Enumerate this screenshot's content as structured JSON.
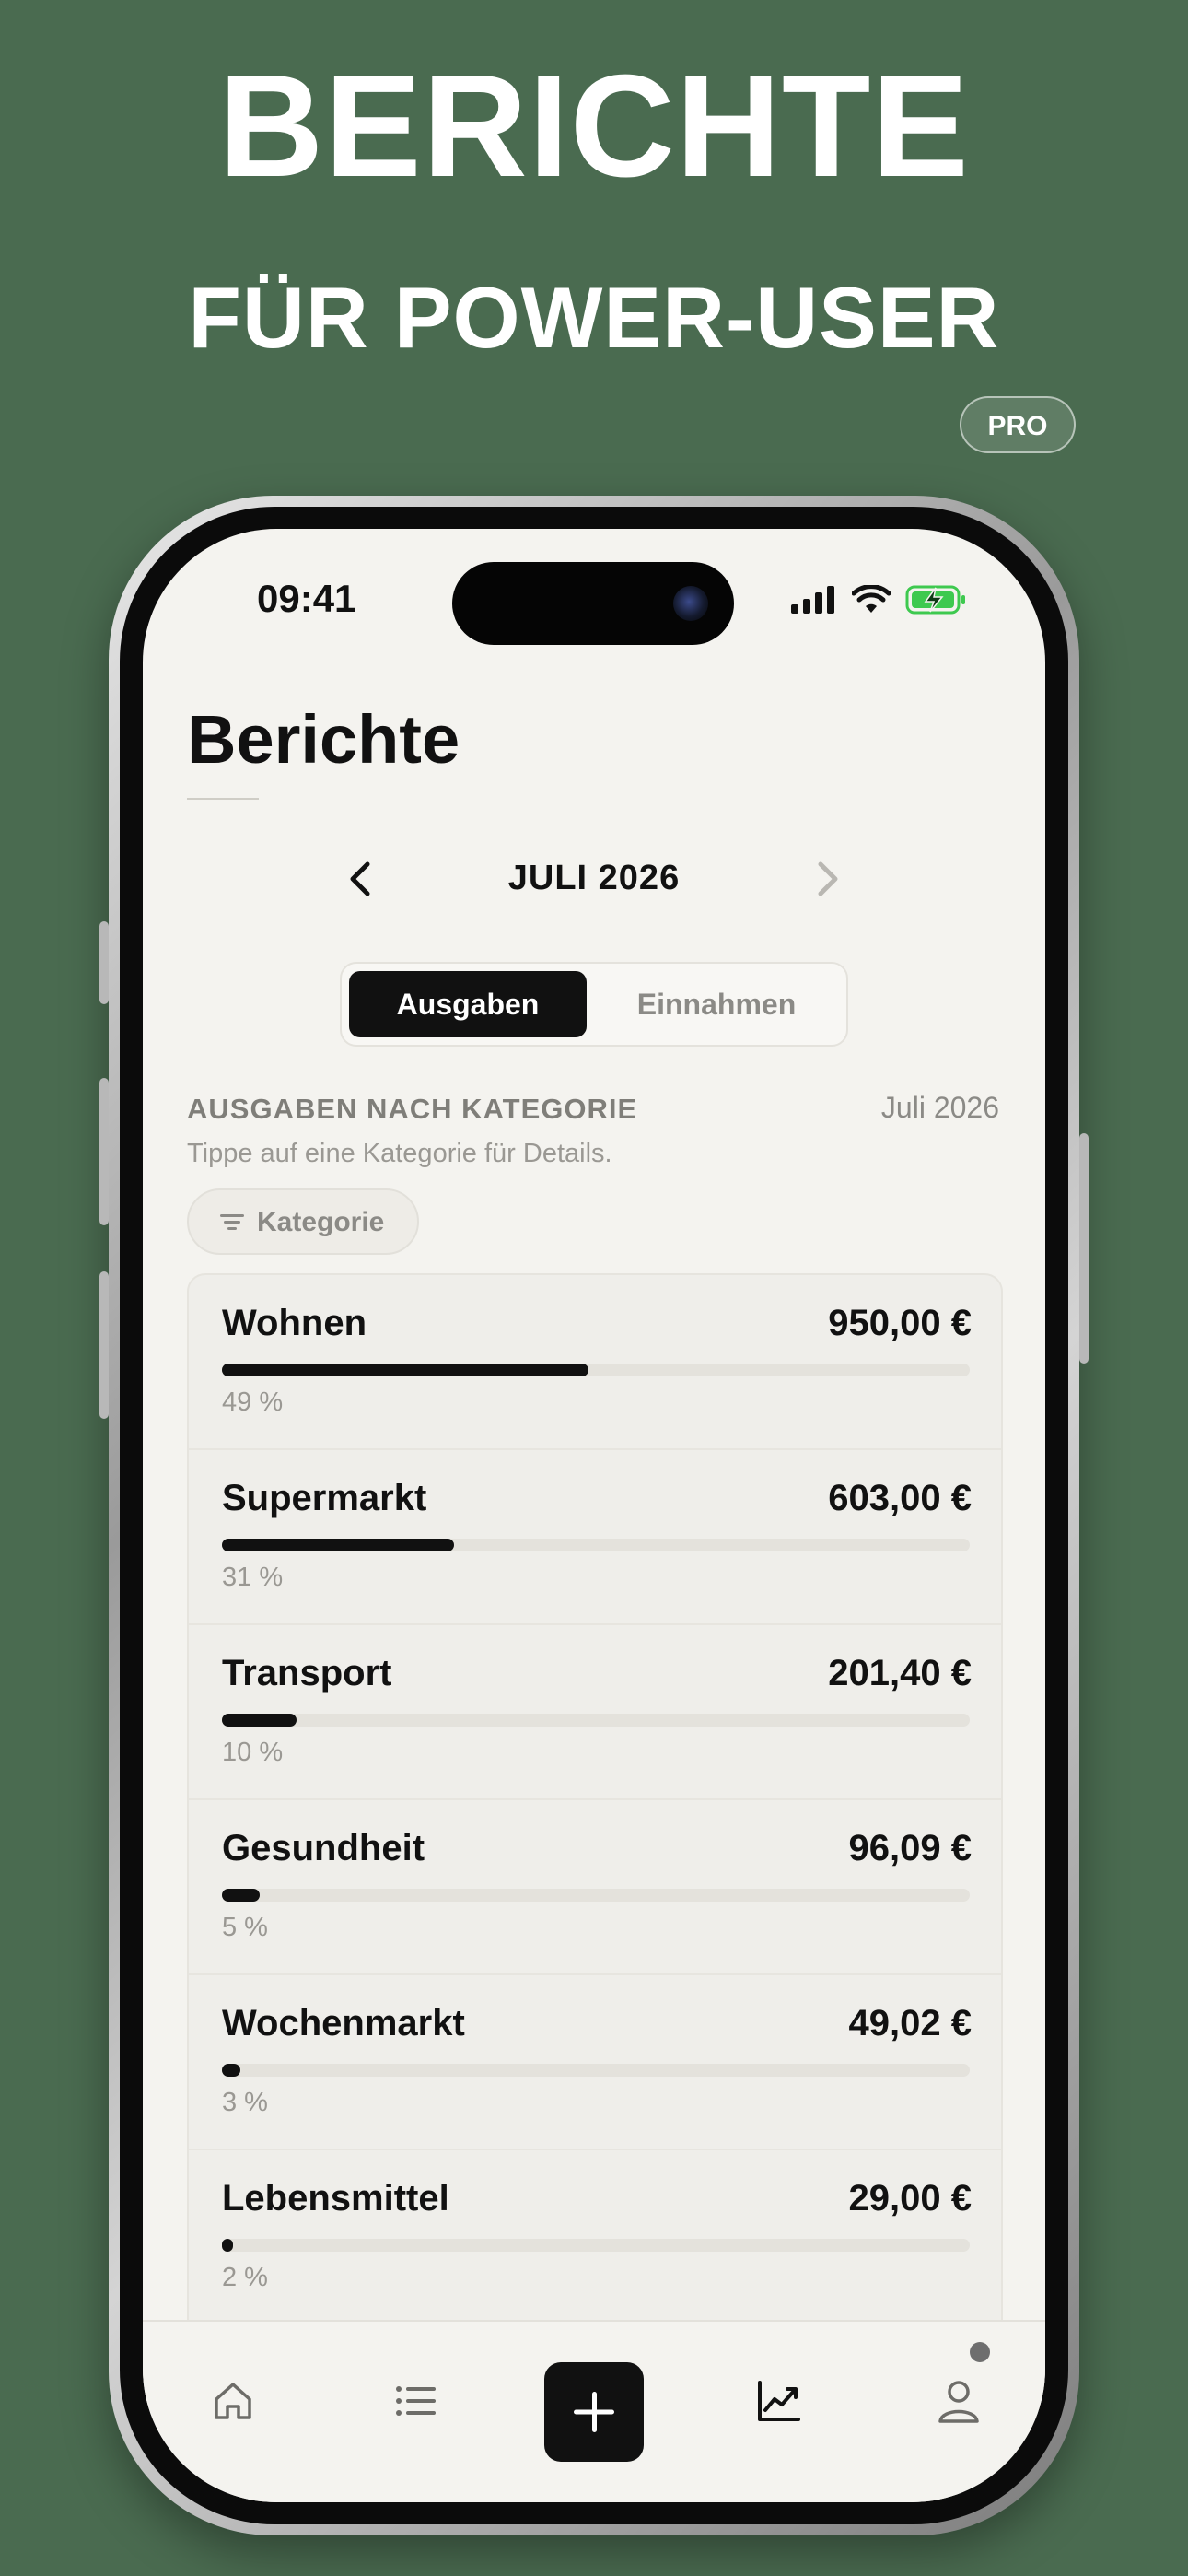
{
  "promo": {
    "headline": "BERICHTE",
    "subheadline": "FÜR POWER-USER",
    "badge": "PRO"
  },
  "status_bar": {
    "time": "09:41",
    "icons": [
      "cellular-signal-icon",
      "wifi-icon",
      "battery-charging-icon"
    ],
    "battery_color": "#3ec94f"
  },
  "screen": {
    "title": "Berichte",
    "month_nav": {
      "label": "JULI 2026",
      "prev_icon": "chevron-left-icon",
      "next_icon": "chevron-right-icon"
    },
    "segmented": {
      "active": "Ausgaben",
      "inactive": "Einnahmen"
    },
    "section": {
      "label": "AUSGABEN NACH KATEGORIE",
      "date": "Juli 2026",
      "hint": "Tippe auf eine Kategorie für Details."
    },
    "filter_chip": {
      "icon": "filter-lines-icon",
      "label": "Kategorie"
    },
    "categories": [
      {
        "name": "Wohnen",
        "amount": "950,00 €",
        "percent_label": "49 %",
        "share": 0.49
      },
      {
        "name": "Supermarkt",
        "amount": "603,00 €",
        "percent_label": "31 %",
        "share": 0.31
      },
      {
        "name": "Transport",
        "amount": "201,40 €",
        "percent_label": "10 %",
        "share": 0.1
      },
      {
        "name": "Gesundheit",
        "amount": "96,09 €",
        "percent_label": "5 %",
        "share": 0.05
      },
      {
        "name": "Wochenmarkt",
        "amount": "49,02 €",
        "percent_label": "3 %",
        "share": 0.025
      },
      {
        "name": "Lebensmittel",
        "amount": "29,00 €",
        "percent_label": "2 %",
        "share": 0.015
      }
    ]
  },
  "tab_bar": {
    "items": [
      "home-icon",
      "list-icon",
      "add-icon",
      "chart-trend-icon",
      "profile-icon"
    ],
    "active": "chart-trend-icon"
  },
  "colors": {
    "background": "#4a6b50",
    "screen": "#f4f3ef",
    "accent": "#111111"
  }
}
